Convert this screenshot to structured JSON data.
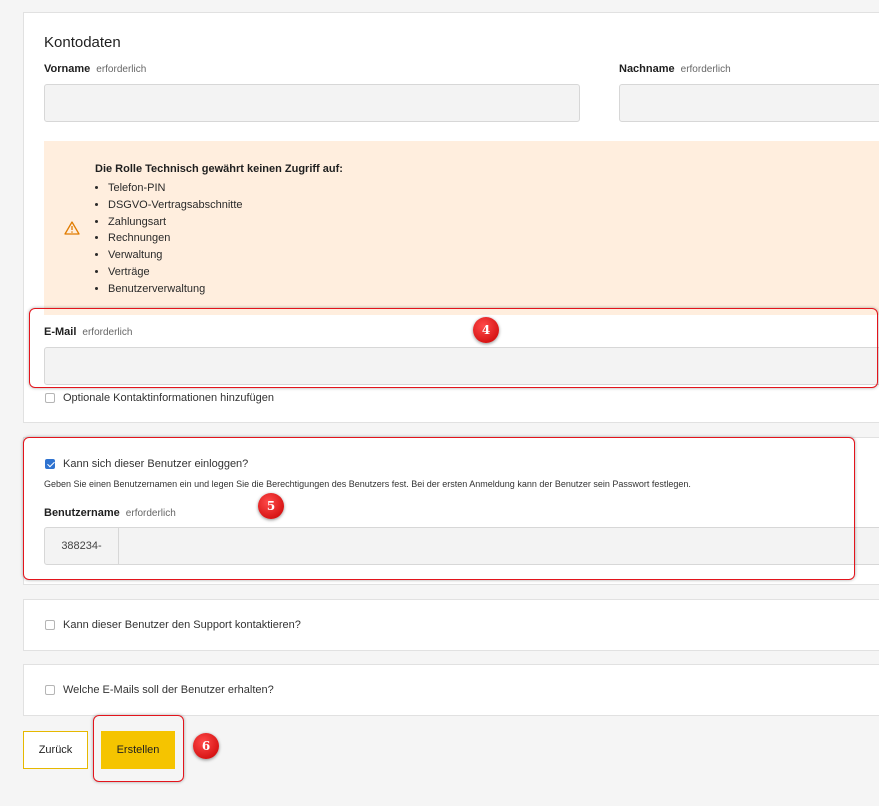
{
  "account": {
    "title": "Kontodaten",
    "required_label": "erforderlich",
    "first_name": {
      "label": "Vorname",
      "value": ""
    },
    "last_name": {
      "label": "Nachname",
      "value": ""
    },
    "email": {
      "label": "E-Mail",
      "value": ""
    }
  },
  "warning": {
    "icon": "warning-triangle-icon",
    "title": "Die Rolle Technisch gewährt keinen Zugriff auf:",
    "items": [
      "Telefon-PIN",
      "DSGVO-Vertragsabschnitte",
      "Zahlungsart",
      "Rechnungen",
      "Verwaltung",
      "Verträge",
      "Benutzerverwaltung"
    ]
  },
  "optional_contact": {
    "label": "Optionale Kontaktinformationen hinzufügen",
    "checked": false
  },
  "login": {
    "checkbox_label": "Kann sich dieser Benutzer einloggen?",
    "checked": true,
    "hint": "Geben Sie einen Benutzernamen ein und legen Sie die Berechtigungen des Benutzers fest. Bei der ersten Anmeldung kann der Benutzer sein Passwort festlegen.",
    "username_label": "Benutzername",
    "username_prefix": "388234-",
    "username_value": ""
  },
  "support": {
    "label": "Kann dieser Benutzer den Support kontaktieren?",
    "checked": false
  },
  "emails": {
    "label": "Welche E-Mails soll der Benutzer erhalten?",
    "checked": false
  },
  "buttons": {
    "back": "Zurück",
    "create": "Erstellen"
  },
  "annotations": {
    "email_step": "4",
    "login_step": "5",
    "create_step": "6"
  },
  "colors": {
    "accent": "#f5c400",
    "callout": "#e3141c",
    "checkbox": "#2f73d0",
    "warning_bg": "#ffeede",
    "warning_icon": "#e07b00"
  }
}
